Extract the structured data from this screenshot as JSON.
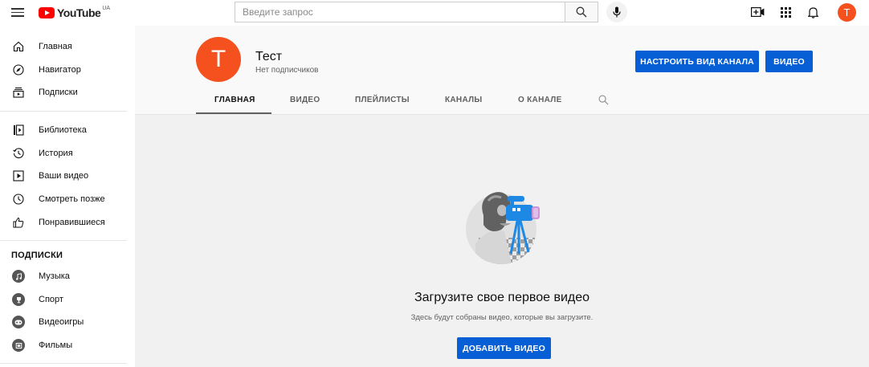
{
  "topbar": {
    "logo_text": "YouTube",
    "logo_region": "UA",
    "search_placeholder": "Введите запрос",
    "avatar_letter": "T",
    "avatar_color": "#f4511e"
  },
  "sidebar": {
    "items_main": [
      {
        "label": "Главная",
        "icon": "home-icon"
      },
      {
        "label": "Навигатор",
        "icon": "compass-icon"
      },
      {
        "label": "Подписки",
        "icon": "subscriptions-icon"
      }
    ],
    "items_library": [
      {
        "label": "Библиотека",
        "icon": "library-icon"
      },
      {
        "label": "История",
        "icon": "history-icon"
      },
      {
        "label": "Ваши видео",
        "icon": "your-videos-icon"
      },
      {
        "label": "Смотреть позже",
        "icon": "watch-later-icon"
      },
      {
        "label": "Понравившиеся",
        "icon": "thumb-up-icon"
      }
    ],
    "subscriptions_heading": "ПОДПИСКИ",
    "subscriptions": [
      {
        "label": "Музыка",
        "icon": "music-icon"
      },
      {
        "label": "Спорт",
        "icon": "trophy-icon"
      },
      {
        "label": "Видеоигры",
        "icon": "gamepad-icon"
      },
      {
        "label": "Фильмы",
        "icon": "film-icon"
      }
    ]
  },
  "channel": {
    "avatar_letter": "T",
    "name": "Тест",
    "subscribers": "Нет подписчиков",
    "customize_label": "НАСТРОИТЬ ВИД КАНАЛА",
    "video_label": "ВИДЕО",
    "tabs": [
      {
        "label": "ГЛАВНАЯ",
        "active": true
      },
      {
        "label": "ВИДЕО",
        "active": false
      },
      {
        "label": "ПЛЕЙЛИСТЫ",
        "active": false
      },
      {
        "label": "КАНАЛЫ",
        "active": false
      },
      {
        "label": "О КАНАЛЕ",
        "active": false
      }
    ]
  },
  "empty_state": {
    "title": "Загрузите свое первое видео",
    "subtitle": "Здесь будут собраны видео, которые вы загрузите.",
    "button_label": "ДОБАВИТЬ ВИДЕО"
  },
  "colors": {
    "accent_blue": "#065fd4",
    "brand_red": "#ff0000"
  }
}
